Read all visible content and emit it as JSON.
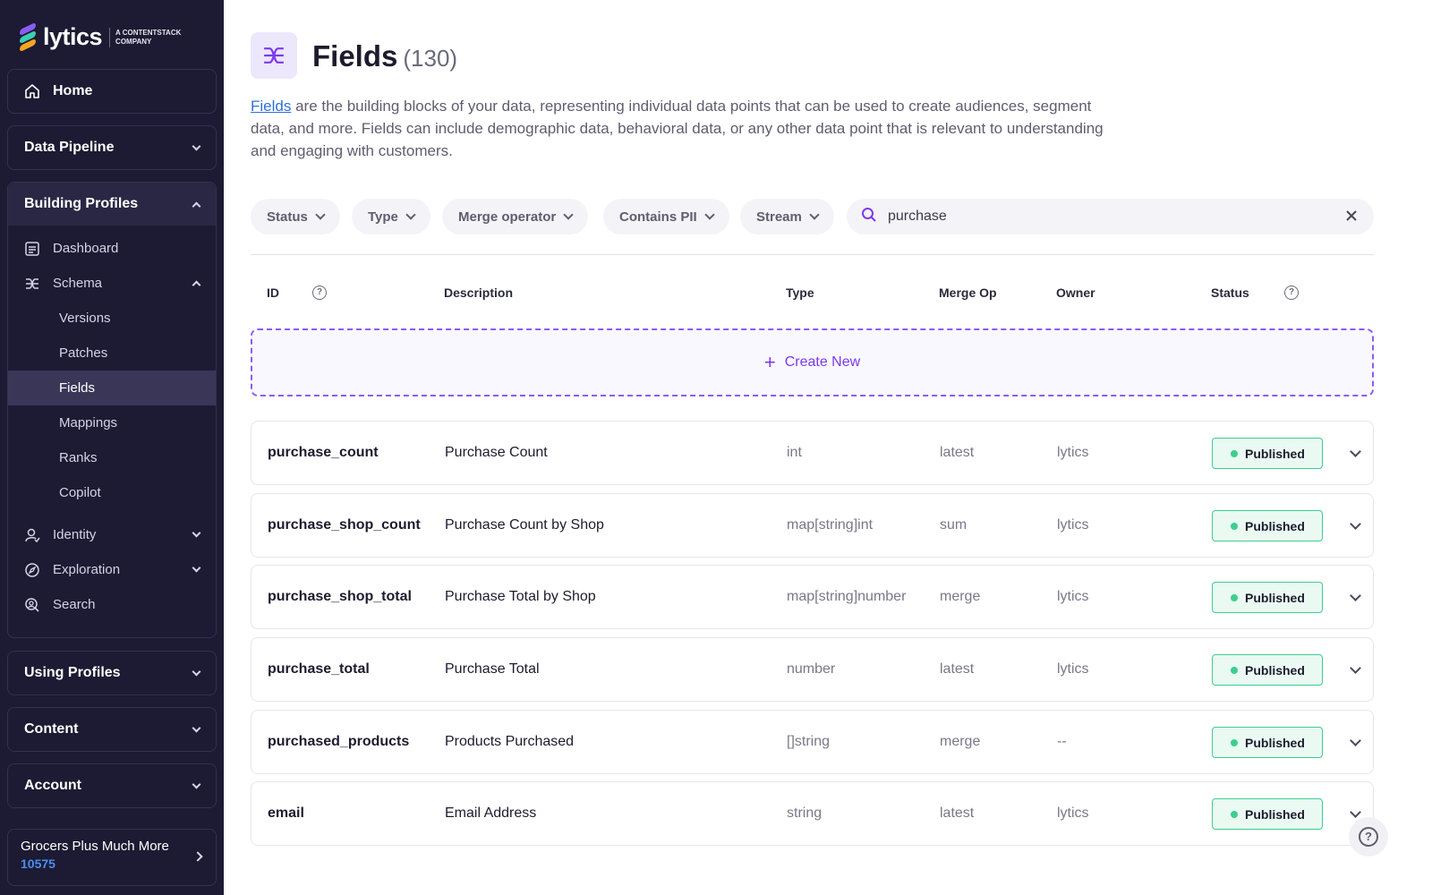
{
  "brand": {
    "logo_text": "lytics",
    "tagline": "A CONTENTSTACK COMPANY",
    "colors": {
      "sidebar_bg": "#1d1a33",
      "accent": "#7c3aed",
      "success": "#3ccf8e",
      "link": "#2e6fd8"
    }
  },
  "sidebar": {
    "home": {
      "label": "Home",
      "icon": "home-icon"
    },
    "data_pipeline": {
      "label": "Data Pipeline",
      "expanded": false
    },
    "building_profiles": {
      "label": "Building Profiles",
      "expanded": true,
      "items": [
        {
          "label": "Dashboard",
          "icon": "dashboard-icon"
        },
        {
          "label": "Schema",
          "icon": "schema-icon",
          "expanded": true
        },
        {
          "label": "Versions"
        },
        {
          "label": "Patches"
        },
        {
          "label": "Fields",
          "active": true
        },
        {
          "label": "Mappings"
        },
        {
          "label": "Ranks"
        },
        {
          "label": "Copilot"
        },
        {
          "label": "Identity",
          "icon": "identity-icon",
          "expanded": false
        },
        {
          "label": "Exploration",
          "icon": "compass-icon",
          "expanded": false
        },
        {
          "label": "Search",
          "icon": "search-user-icon"
        }
      ]
    },
    "using_profiles": {
      "label": "Using Profiles",
      "expanded": false
    },
    "content": {
      "label": "Content",
      "expanded": false
    },
    "account": {
      "label": "Account",
      "expanded": false
    },
    "org": {
      "name": "Grocers Plus Much More",
      "id": "10575"
    }
  },
  "header": {
    "title": "Fields",
    "count": "(130)",
    "description_link": "Fields",
    "description_rest": " are the building blocks of your data, representing individual data points that can be used to create audiences, segment data, and more. Fields can include demographic data, behavioral data, or any other data point that is relevant to understanding and engaging with customers."
  },
  "filters": {
    "status": "Status",
    "type": "Type",
    "merge_operator": "Merge operator",
    "contains_pii": "Contains PII",
    "stream": "Stream",
    "search_value": "purchase"
  },
  "table": {
    "columns": {
      "id": "ID",
      "description": "Description",
      "type": "Type",
      "merge_op": "Merge Op",
      "owner": "Owner",
      "status": "Status"
    },
    "create_new": "Create New",
    "rows": [
      {
        "id": "purchase_count",
        "description": "Purchase Count",
        "type": "int",
        "merge_op": "latest",
        "owner": "lytics",
        "status": "Published"
      },
      {
        "id": "purchase_shop_count",
        "description": "Purchase Count by Shop",
        "type": "map[string]int",
        "merge_op": "sum",
        "owner": "lytics",
        "status": "Published"
      },
      {
        "id": "purchase_shop_total",
        "description": "Purchase Total by Shop",
        "type": "map[string]number",
        "merge_op": "merge",
        "owner": "lytics",
        "status": "Published"
      },
      {
        "id": "purchase_total",
        "description": "Purchase Total",
        "type": "number",
        "merge_op": "latest",
        "owner": "lytics",
        "status": "Published"
      },
      {
        "id": "purchased_products",
        "description": "Products Purchased",
        "type": "[]string",
        "merge_op": "merge",
        "owner": "--",
        "status": "Published"
      },
      {
        "id": "email",
        "description": "Email Address",
        "type": "string",
        "merge_op": "latest",
        "owner": "lytics",
        "status": "Published"
      }
    ]
  }
}
